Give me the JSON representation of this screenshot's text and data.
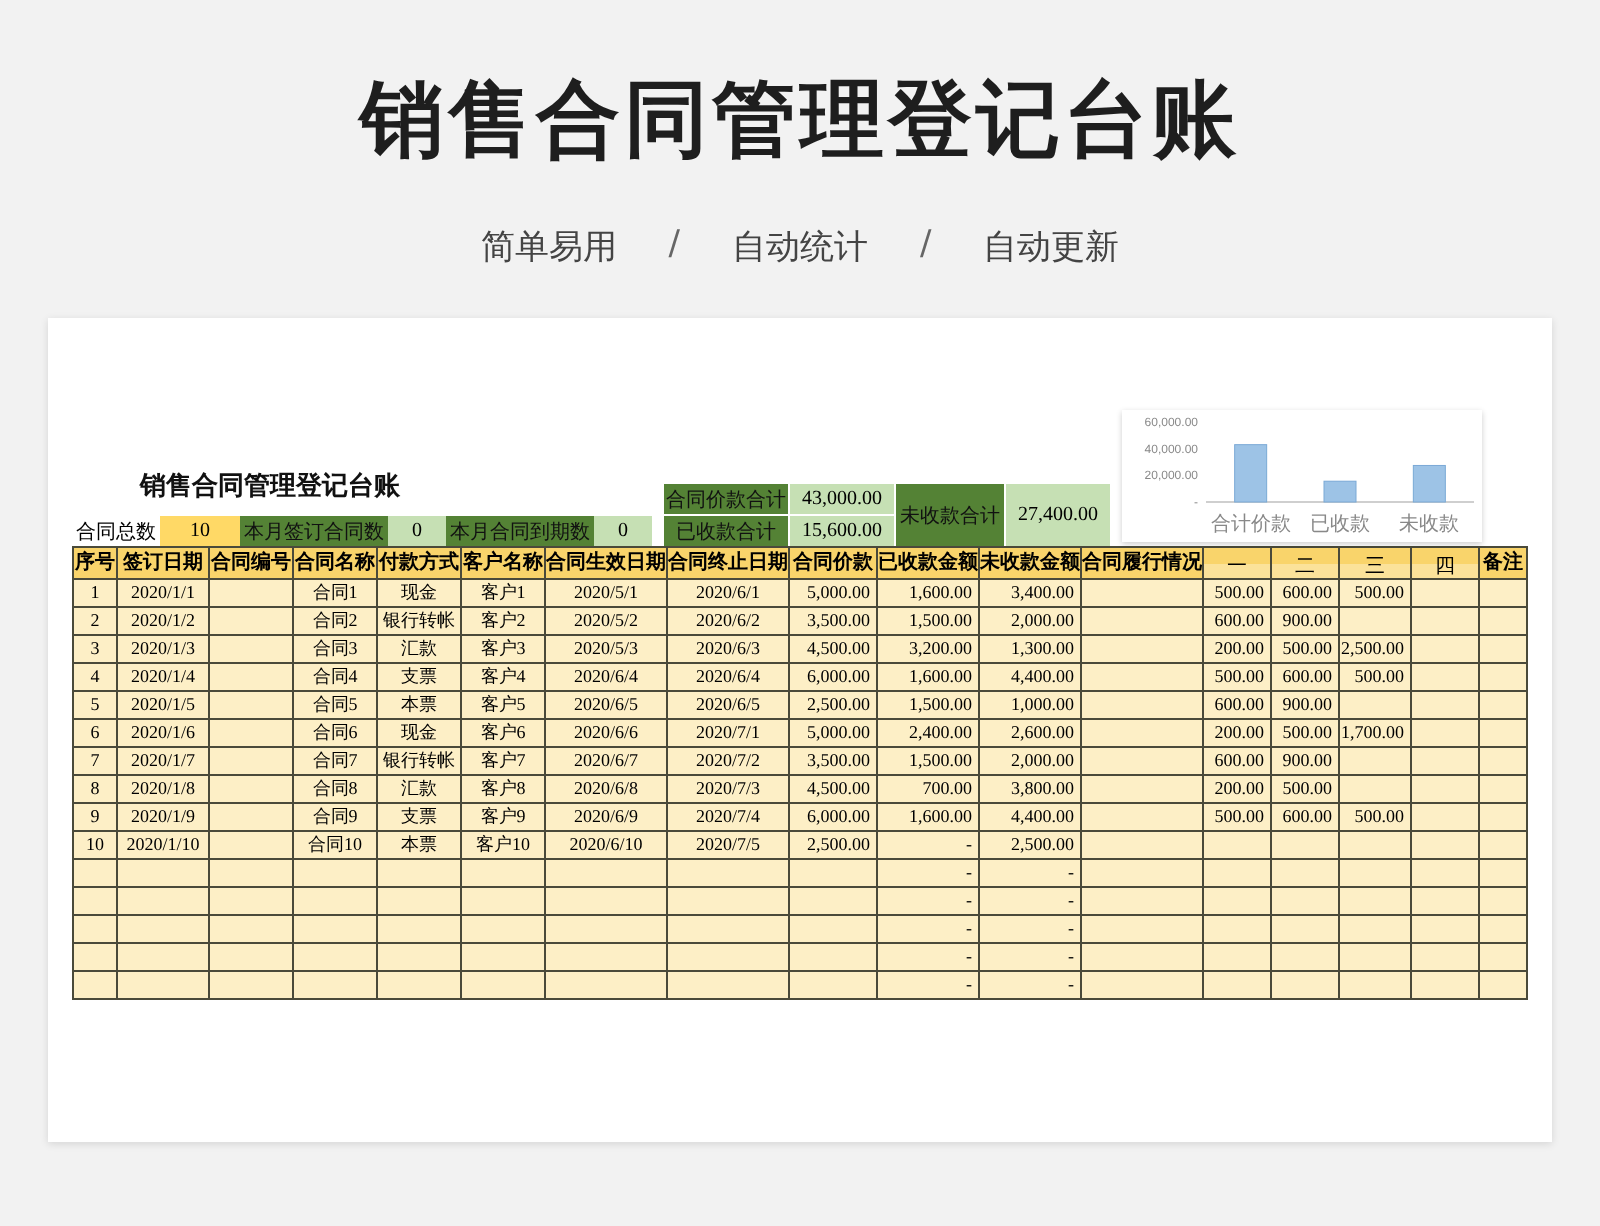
{
  "title": "销售合同管理登记台账",
  "subtitle": [
    "简单易用",
    "/",
    "自动统计",
    "/",
    "自动更新"
  ],
  "sheet": {
    "title": "销售合同管理登记台账",
    "summary": [
      {
        "label": "合同总数",
        "value": "10",
        "kind": "yellow"
      },
      {
        "label": "本月签订合同数",
        "value": "0",
        "kind": "green"
      },
      {
        "label": "本月合同到期数",
        "value": "0",
        "kind": "green"
      }
    ],
    "totals": {
      "price_label": "合同价款合计",
      "price": "43,000.00",
      "received_label": "已收款合计",
      "received": "15,600.00",
      "outstanding_label": "未收款合计",
      "outstanding": "27,400.00"
    },
    "chart_data": {
      "type": "bar",
      "categories": [
        "合计价款",
        "已收款",
        "未收款"
      ],
      "values": [
        43000,
        15600,
        27400
      ],
      "ylim": [
        0,
        60000
      ],
      "yticks": [
        {
          "value": 0,
          "label": "-"
        },
        {
          "value": 20000,
          "label": "20,000.00"
        },
        {
          "value": 40000,
          "label": "40,000.00"
        },
        {
          "value": 60000,
          "label": "60,000.00"
        }
      ]
    },
    "columns": [
      {
        "label": "序号",
        "kind": "text",
        "sub": false
      },
      {
        "label": "签订日期",
        "kind": "text",
        "sub": false
      },
      {
        "label": "合同编号",
        "kind": "text",
        "sub": false
      },
      {
        "label": "合同名称",
        "kind": "text",
        "sub": false
      },
      {
        "label": "付款方式",
        "kind": "text",
        "sub": false
      },
      {
        "label": "客户名称",
        "kind": "text",
        "sub": false
      },
      {
        "label": "合同生效日期",
        "kind": "text",
        "sub": false
      },
      {
        "label": "合同终止日期",
        "kind": "text",
        "sub": false
      },
      {
        "label": "合同价款",
        "kind": "amount",
        "sub": false
      },
      {
        "label": "已收款金额",
        "kind": "amount",
        "sub": false
      },
      {
        "label": "未收款金额",
        "kind": "amount",
        "sub": false
      },
      {
        "label": "合同履行情况",
        "kind": "text",
        "sub": false
      },
      {
        "label": "一",
        "kind": "amount",
        "sub": true
      },
      {
        "label": "二",
        "kind": "amount",
        "sub": true
      },
      {
        "label": "三",
        "kind": "amount",
        "sub": true
      },
      {
        "label": "四",
        "kind": "amount",
        "sub": true
      },
      {
        "label": "备注",
        "kind": "text",
        "sub": false
      }
    ],
    "rows": [
      {
        "no": "1",
        "sign": "2020/1/1",
        "name": "合同1",
        "pay": "现金",
        "cust": "客户1",
        "start": "2020/5/1",
        "end": "2020/6/1",
        "price": "5,000.00",
        "rec": "1,600.00",
        "out": "3,400.00",
        "q1": "500.00",
        "q2": "600.00",
        "q3": "500.00"
      },
      {
        "no": "2",
        "sign": "2020/1/2",
        "name": "合同2",
        "pay": "银行转帐",
        "cust": "客户2",
        "start": "2020/5/2",
        "end": "2020/6/2",
        "price": "3,500.00",
        "rec": "1,500.00",
        "out": "2,000.00",
        "q1": "600.00",
        "q2": "900.00"
      },
      {
        "no": "3",
        "sign": "2020/1/3",
        "name": "合同3",
        "pay": "汇款",
        "cust": "客户3",
        "start": "2020/5/3",
        "end": "2020/6/3",
        "price": "4,500.00",
        "rec": "3,200.00",
        "out": "1,300.00",
        "q1": "200.00",
        "q2": "500.00",
        "q3": "2,500.00"
      },
      {
        "no": "4",
        "sign": "2020/1/4",
        "name": "合同4",
        "pay": "支票",
        "cust": "客户4",
        "start": "2020/6/4",
        "end": "2020/6/4",
        "price": "6,000.00",
        "rec": "1,600.00",
        "out": "4,400.00",
        "q1": "500.00",
        "q2": "600.00",
        "q3": "500.00"
      },
      {
        "no": "5",
        "sign": "2020/1/5",
        "name": "合同5",
        "pay": "本票",
        "cust": "客户5",
        "start": "2020/6/5",
        "end": "2020/6/5",
        "price": "2,500.00",
        "rec": "1,500.00",
        "out": "1,000.00",
        "q1": "600.00",
        "q2": "900.00"
      },
      {
        "no": "6",
        "sign": "2020/1/6",
        "name": "合同6",
        "pay": "现金",
        "cust": "客户6",
        "start": "2020/6/6",
        "end": "2020/7/1",
        "price": "5,000.00",
        "rec": "2,400.00",
        "out": "2,600.00",
        "q1": "200.00",
        "q2": "500.00",
        "q3": "1,700.00"
      },
      {
        "no": "7",
        "sign": "2020/1/7",
        "name": "合同7",
        "pay": "银行转帐",
        "cust": "客户7",
        "start": "2020/6/7",
        "end": "2020/7/2",
        "price": "3,500.00",
        "rec": "1,500.00",
        "out": "2,000.00",
        "q1": "600.00",
        "q2": "900.00"
      },
      {
        "no": "8",
        "sign": "2020/1/8",
        "name": "合同8",
        "pay": "汇款",
        "cust": "客户8",
        "start": "2020/6/8",
        "end": "2020/7/3",
        "price": "4,500.00",
        "rec": "700.00",
        "out": "3,800.00",
        "q1": "200.00",
        "q2": "500.00"
      },
      {
        "no": "9",
        "sign": "2020/1/9",
        "name": "合同9",
        "pay": "支票",
        "cust": "客户9",
        "start": "2020/6/9",
        "end": "2020/7/4",
        "price": "6,000.00",
        "rec": "1,600.00",
        "out": "4,400.00",
        "q1": "500.00",
        "q2": "600.00",
        "q3": "500.00"
      },
      {
        "no": "10",
        "sign": "2020/1/10",
        "name": "合同10",
        "pay": "本票",
        "cust": "客户10",
        "start": "2020/6/10",
        "end": "2020/7/5",
        "price": "2,500.00",
        "rec": "-",
        "out": "2,500.00"
      },
      {
        "rec": "-",
        "out": "-"
      },
      {
        "rec": "-",
        "out": "-"
      },
      {
        "rec": "-",
        "out": "-"
      },
      {
        "rec": "-",
        "out": "-"
      },
      {
        "rec": "-",
        "out": "-"
      }
    ]
  }
}
